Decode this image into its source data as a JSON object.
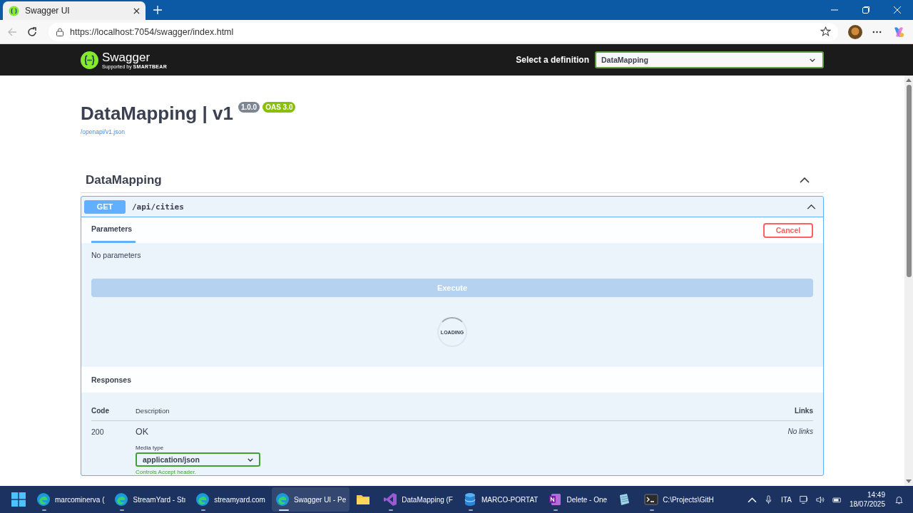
{
  "browser": {
    "tab": {
      "title": "Swagger UI"
    },
    "url": "https://localhost:7054/swagger/index.html"
  },
  "topbar": {
    "brand": "Swagger",
    "tagline": "Supported by",
    "company": "SMARTBEAR",
    "definition_label": "Select a definition",
    "definition_value": "DataMapping"
  },
  "info": {
    "title": "DataMapping | v1",
    "version": "1.0.0",
    "oas": "OAS 3.0",
    "spec_link": "/openapi/v1.json"
  },
  "section": {
    "name": "DataMapping",
    "expanded": true
  },
  "operation": {
    "method": "GET",
    "path": "/api/cities",
    "expanded": true,
    "tabs": [
      {
        "label": "Parameters",
        "selected": true
      }
    ],
    "cancel": "Cancel",
    "no_params": "No parameters",
    "execute": "Execute",
    "execute_disabled": true,
    "loading": "LOADING",
    "responses_title": "Responses",
    "columns": [
      "Code",
      "Description",
      "Links"
    ],
    "responses": [
      {
        "code": "200",
        "description": "OK",
        "media_label": "Media type",
        "media_value": "application/json",
        "media_hint": "Controls Accept header.",
        "links": "No links"
      }
    ]
  },
  "taskbar": {
    "apps": [
      {
        "kind": "edge",
        "label": "marcominerva (",
        "running": true,
        "selected": false
      },
      {
        "kind": "edge",
        "label": "StreamYard - Stı",
        "running": true,
        "selected": false
      },
      {
        "kind": "edge",
        "label": "streamyard.com",
        "running": true,
        "selected": false
      },
      {
        "kind": "edge",
        "label": "Swagger UI - Pe",
        "running": true,
        "selected": true
      },
      {
        "kind": "folder",
        "running": false,
        "selected": false
      },
      {
        "kind": "vs",
        "label": "DataMapping (F",
        "running": true,
        "selected": false
      },
      {
        "kind": "remote",
        "label": "MARCO-PORTAT",
        "running": true,
        "selected": false
      },
      {
        "kind": "onenote",
        "label": "Delete - One",
        "running": true,
        "selected": false
      },
      {
        "kind": "notepad",
        "running": false,
        "selected": false
      },
      {
        "kind": "terminal",
        "label": "C:\\Projects\\GitH",
        "running": true,
        "selected": false
      }
    ],
    "language": "ITA",
    "time": "14:49",
    "date": "18/07/2025"
  }
}
